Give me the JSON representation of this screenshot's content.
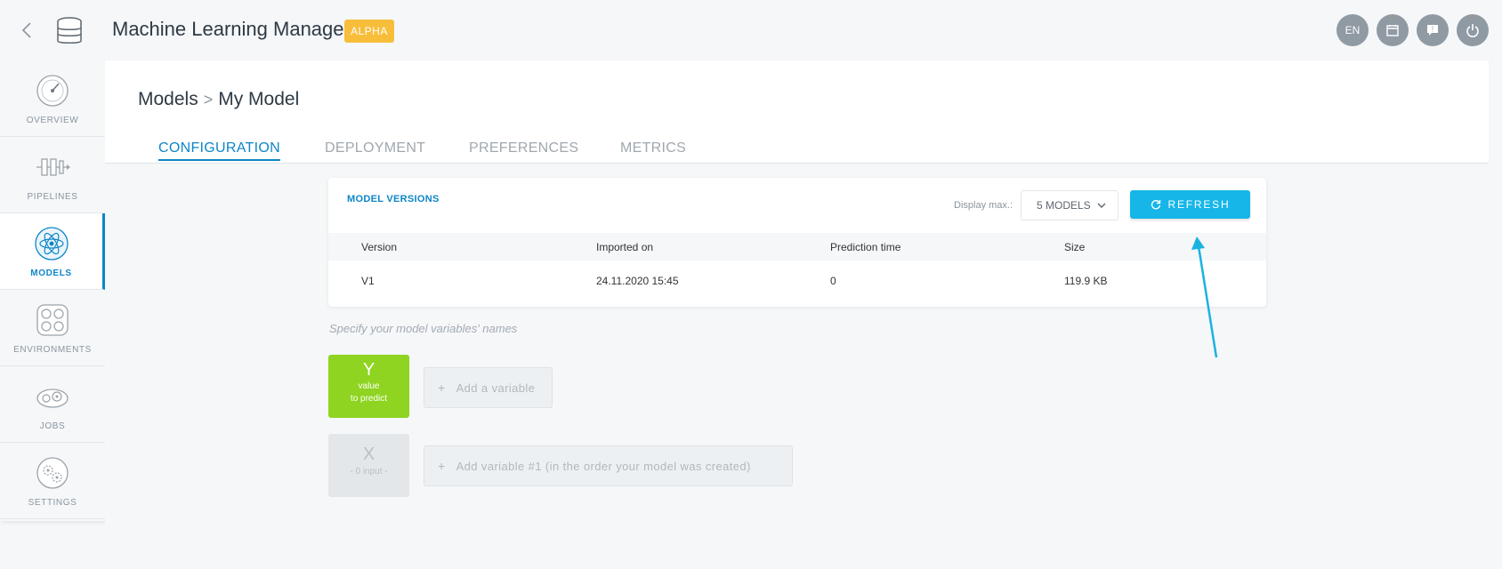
{
  "header": {
    "title": "Machine Learning Manager",
    "badge": "ALPHA",
    "lang": "EN"
  },
  "sidebar": {
    "items": [
      {
        "label": "OVERVIEW",
        "icon": "gauge-icon"
      },
      {
        "label": "PIPELINES",
        "icon": "pipeline-icon"
      },
      {
        "label": "MODELS",
        "icon": "atom-icon",
        "active": true
      },
      {
        "label": "ENVIRONMENTS",
        "icon": "network-icon"
      },
      {
        "label": "JOBS",
        "icon": "gears-icon"
      },
      {
        "label": "SETTINGS",
        "icon": "cogs-icon"
      }
    ]
  },
  "breadcrumb": {
    "root": "Models",
    "sep": ">",
    "current": "My Model"
  },
  "tabs": [
    {
      "label": "CONFIGURATION",
      "active": true
    },
    {
      "label": "DEPLOYMENT"
    },
    {
      "label": "PREFERENCES"
    },
    {
      "label": "METRICS"
    }
  ],
  "versions": {
    "title": "MODEL VERSIONS",
    "display_label": "Display max.:",
    "display_value": "5 MODELS",
    "refresh_label": "REFRESH",
    "columns": [
      "Version",
      "Imported on",
      "Prediction time",
      "Size"
    ],
    "rows": [
      [
        "V1",
        "24.11.2020 15:45",
        "0",
        "119.9 KB"
      ]
    ]
  },
  "variables": {
    "hint": "Specify your model variables' names",
    "y": {
      "letter": "Y",
      "line1": "value",
      "line2": "to predict",
      "add": "Add a variable"
    },
    "x": {
      "letter": "X",
      "sub": "- 0 input -",
      "add": "Add variable #1 (in the order your model was created)"
    },
    "plus": "+"
  },
  "colors": {
    "accent": "#0d86c7",
    "refresh": "#16b6e8",
    "badge": "#f8be3a",
    "y_var": "#8ed420",
    "arrow": "#1bb2e0"
  }
}
